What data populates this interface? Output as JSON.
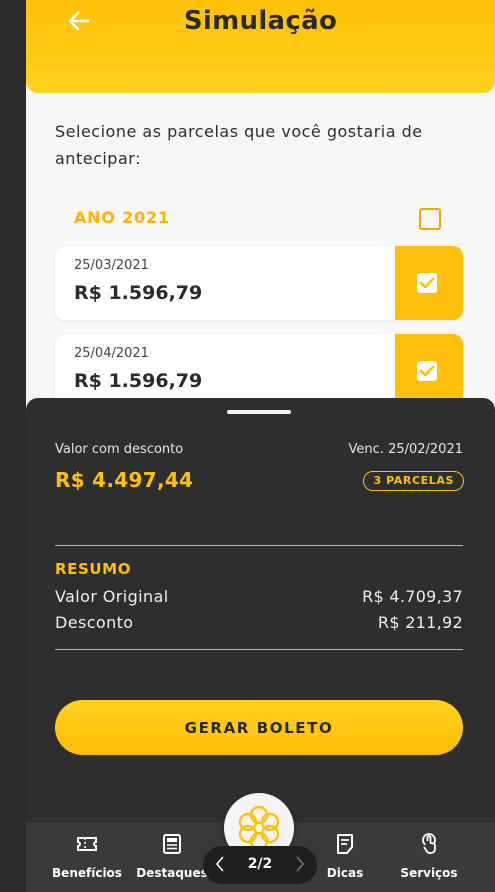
{
  "header": {
    "title": "Simulação"
  },
  "instructions": "Selecione as parcelas que você gostaria de antecipar:",
  "year_group": {
    "label": "ANO 2021",
    "checked": false
  },
  "installments": [
    {
      "date": "25/03/2021",
      "value": "R$ 1.596,79",
      "checked": true
    },
    {
      "date": "25/04/2021",
      "value": "R$ 1.596,79",
      "checked": true
    }
  ],
  "summary_sheet": {
    "discount_label": "Valor com desconto",
    "due_label": "Venc. 25/02/2021",
    "discount_value": "R$ 4.497,44",
    "parcelas_badge": "3 PARCELAS",
    "resumo_title": "RESUMO",
    "rows": [
      {
        "label": "Valor Original",
        "value": "R$ 4.709,37"
      },
      {
        "label": "Desconto",
        "value": "R$ 211,92"
      }
    ],
    "button_label": "GERAR BOLETO"
  },
  "bottom_nav": {
    "items": [
      {
        "label": "Benefícios",
        "icon": "ticket-icon"
      },
      {
        "label": "Destaques",
        "icon": "newspaper-icon"
      },
      {
        "label": "Dicas",
        "icon": "notepad-icon"
      },
      {
        "label": "Serviços",
        "icon": "hand-pointer-icon"
      }
    ],
    "center_icon": "flower-logo-icon",
    "pager": "2/2"
  },
  "colors": {
    "accent": "#ffc107",
    "sheet_bg": "#2e2e2e",
    "nav_bg": "#3a3a3a"
  }
}
